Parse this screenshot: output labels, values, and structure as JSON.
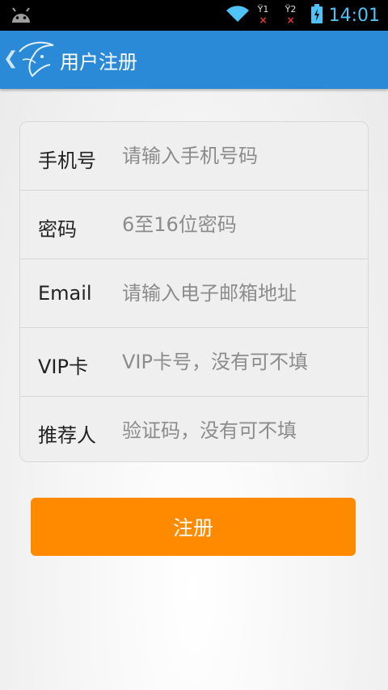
{
  "status_bar": {
    "time": "14:01",
    "sim1_label": "1",
    "sim2_label": "2",
    "icons": [
      "android-icon",
      "wifi-icon",
      "sim1-no-signal-icon",
      "sim2-no-signal-icon",
      "battery-charging-icon"
    ]
  },
  "action_bar": {
    "title": "用户注册",
    "back_glyph": "❮"
  },
  "form": {
    "fields": [
      {
        "label": "手机号",
        "placeholder": "请输入手机号码",
        "value": ""
      },
      {
        "label": "密码",
        "placeholder": "6至16位密码",
        "value": ""
      },
      {
        "label": "Email",
        "placeholder": "请输入电子邮箱地址",
        "value": ""
      },
      {
        "label": "VIP卡",
        "placeholder": "VIP卡号，没有可不填",
        "value": ""
      },
      {
        "label": "推荐人",
        "placeholder": "验证码，没有可不填",
        "value": ""
      }
    ]
  },
  "register_button": {
    "label": "注册"
  },
  "colors": {
    "action_bar": "#2b8ad7",
    "button": "#ff8a00",
    "status_time": "#4fc3f7"
  }
}
